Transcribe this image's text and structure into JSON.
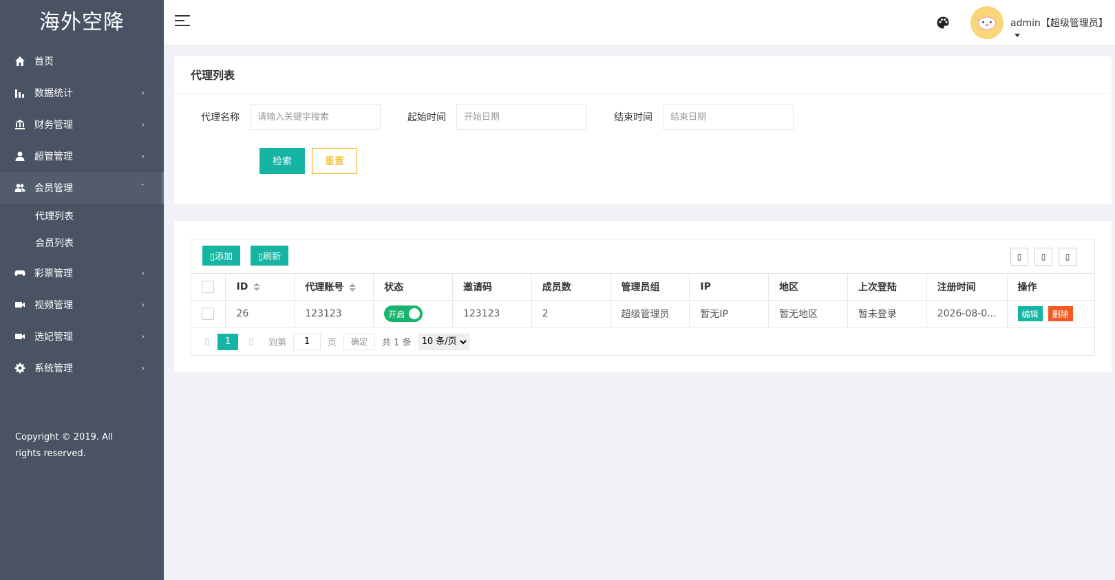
{
  "app": {
    "title": "海外空降"
  },
  "sidebar": {
    "items": [
      {
        "label": "首页",
        "icon": "home-icon",
        "has_arrow": false
      },
      {
        "label": "数据统计",
        "icon": "bar-chart-icon",
        "has_arrow": true
      },
      {
        "label": "财务管理",
        "icon": "bank-icon",
        "has_arrow": true
      },
      {
        "label": "超管管理",
        "icon": "user-icon",
        "has_arrow": true
      },
      {
        "label": "会员管理",
        "icon": "users-icon",
        "has_arrow": true,
        "open": true
      },
      {
        "label": "彩票管理",
        "icon": "gamepad-icon",
        "has_arrow": true
      },
      {
        "label": "视频管理",
        "icon": "video-icon",
        "has_arrow": true
      },
      {
        "label": "选妃管理",
        "icon": "video-icon",
        "has_arrow": true
      },
      {
        "label": "系统管理",
        "icon": "gear-icon",
        "has_arrow": true
      }
    ],
    "sub_items": [
      {
        "label": "代理列表"
      },
      {
        "label": "会员列表"
      }
    ],
    "arrow_right": "›",
    "arrow_down": "ˇ",
    "copyright": "Copyright © 2019. All rights reserved."
  },
  "header": {
    "user": "admin【超级管理员】",
    "theme_icon": "palette-icon",
    "menu_icon": "menu-toggle-icon"
  },
  "search": {
    "title": "代理列表",
    "fields": [
      {
        "label": "代理名称",
        "placeholder": "请输入关键字搜索"
      },
      {
        "label": "起始时间",
        "placeholder": "开始日期"
      },
      {
        "label": "结束时间",
        "placeholder": "结束日期"
      }
    ],
    "search_label": "检索",
    "reset_label": "重置"
  },
  "toolbar": {
    "add_label": "添加",
    "refresh_label": "刷新",
    "icon_glyph": "▯"
  },
  "table": {
    "columns": [
      "ID",
      "代理账号",
      "状态",
      "邀请码",
      "成员数",
      "管理员组",
      "IP",
      "地区",
      "上次登陆",
      "注册时间",
      "操作"
    ],
    "rows": [
      {
        "id": "26",
        "account": "123123",
        "status": "开启",
        "invite_code": "123123",
        "members": "2",
        "group": "超级管理员",
        "ip": "暂无IP",
        "region": "暂无地区",
        "last_login": "暂未登录",
        "register_time": "2026-08-0...",
        "edit_label": "编辑",
        "delete_label": "删除"
      }
    ]
  },
  "pager": {
    "prev": "▯",
    "next": "▯",
    "current": "1",
    "goto_label": "到第",
    "goto_value": "1",
    "page_label": "页",
    "confirm_label": "确定",
    "total_label": "共 1 条",
    "page_size": "10 条/页"
  },
  "colors": {
    "sidebar_bg": "#4a5364",
    "accent": "#16b4a3",
    "warning": "#f0b000",
    "danger": "#f35a21",
    "switch_on": "#16b46d"
  }
}
